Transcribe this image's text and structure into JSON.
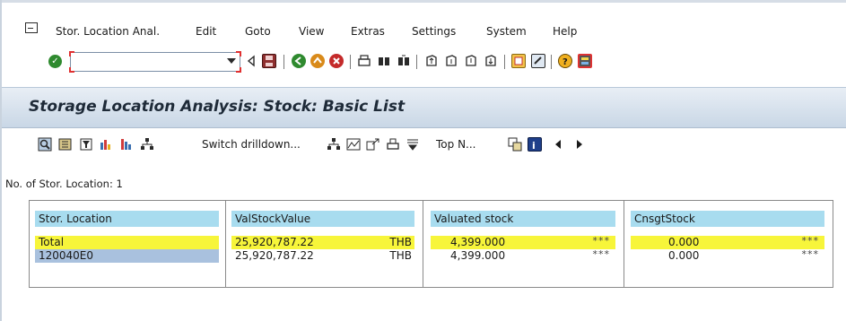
{
  "menu": {
    "items": [
      "Stor. Location Anal.",
      "Edit",
      "Goto",
      "View",
      "Extras",
      "Settings",
      "System",
      "Help"
    ]
  },
  "toolbar": {
    "command_value": "",
    "icons": [
      "enter-icon",
      "back-icon",
      "save-icon",
      "back-arrow-icon",
      "exit-icon",
      "cancel-icon",
      "print-icon",
      "find-icon",
      "find-next-icon",
      "first-page-icon",
      "previous-page-icon",
      "next-page-icon",
      "last-page-icon",
      "create-session-icon",
      "shortcut-icon",
      "help-icon",
      "layout-menu-icon"
    ]
  },
  "title": "Storage Location Analysis: Stock: Basic List",
  "app_toolbar": {
    "switch_drilldown_label": "Switch drilldown...",
    "top_n_label": "Top N..."
  },
  "count_label": "No. of Stor. Location: 1",
  "table": {
    "columns": {
      "location": "Stor. Location",
      "valstock": "ValStockValue",
      "valuated": "Valuated stock",
      "cnsgt": "CnsgtStock"
    },
    "rows": [
      {
        "location": "Total",
        "valstock": "25,920,787.22",
        "currency": "THB",
        "valuated": "4,399.000",
        "valuated_flag": "***",
        "cnsgt": "0.000",
        "cnsgt_flag": "***"
      },
      {
        "location": "120040E0",
        "valstock": "25,920,787.22",
        "currency": "THB",
        "valuated": "4,399.000",
        "valuated_flag": "***",
        "cnsgt": "0.000",
        "cnsgt_flag": "***"
      }
    ]
  },
  "colors": {
    "total_highlight": "#f7f53a",
    "header_cell": "#a8dcef",
    "key_cell": "#a9c1de",
    "title_band": "#c9d7e6"
  }
}
